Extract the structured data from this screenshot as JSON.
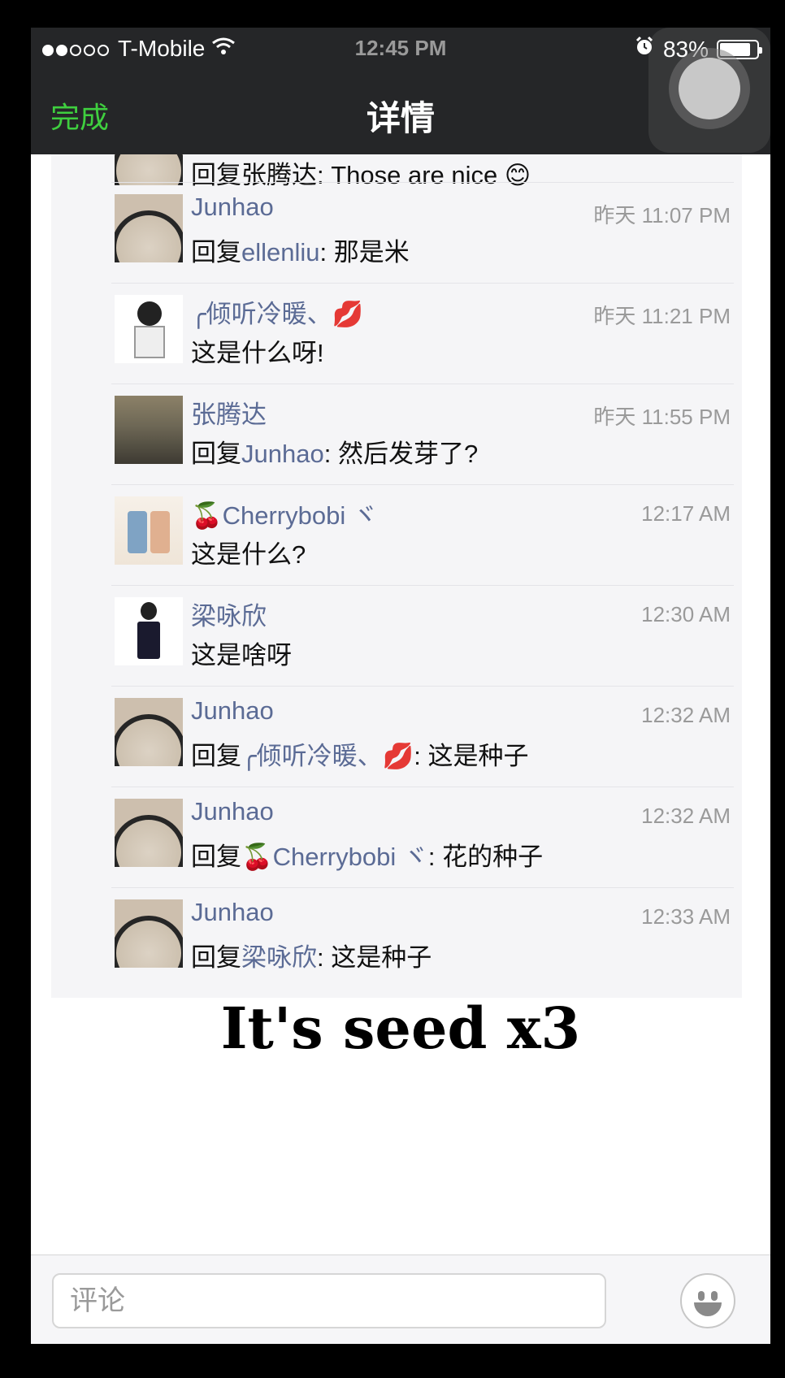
{
  "status_bar": {
    "carrier": "T-Mobile",
    "time": "12:45 PM",
    "battery": "83%",
    "battery_level": 0.83,
    "signal_bars_filled": 2,
    "signal_bars_total": 5
  },
  "nav": {
    "done_label": "完成",
    "title": "详情",
    "accent_color": "#3fcf3f"
  },
  "comments": {
    "partial_text": "回复张腾达: Those are nice 😊",
    "items": [
      {
        "name": "Junhao",
        "time": "昨天 11:07 PM",
        "reply_prefix": "回复",
        "reply_to": "ellenliu",
        "message": ": 那是米"
      },
      {
        "name": "╭倾听冷暖、💋",
        "time": "昨天 11:21 PM",
        "reply_prefix": "",
        "reply_to": "",
        "message": "这是什么呀!"
      },
      {
        "name": "张腾达",
        "time": "昨天 11:55 PM",
        "reply_prefix": "回复",
        "reply_to": "Junhao",
        "message": ": 然后发芽了?"
      },
      {
        "name": "🍒Cherrybobi ヾ",
        "time": "12:17 AM",
        "reply_prefix": "",
        "reply_to": "",
        "message": "这是什么?"
      },
      {
        "name": "梁咏欣",
        "time": "12:30 AM",
        "reply_prefix": "",
        "reply_to": "",
        "message": "这是啥呀"
      },
      {
        "name": "Junhao",
        "time": "12:32 AM",
        "reply_prefix": "回复",
        "reply_to": "╭倾听冷暖、💋",
        "message": ": 这是种子"
      },
      {
        "name": "Junhao",
        "time": "12:32 AM",
        "reply_prefix": "回复",
        "reply_to": "🍒Cherrybobi ヾ",
        "message": ": 花的种子"
      },
      {
        "name": "Junhao",
        "time": "12:33 AM",
        "reply_prefix": "回复",
        "reply_to": "梁咏欣",
        "message": ": 这是种子"
      }
    ]
  },
  "caption": "It's seed x3",
  "input": {
    "placeholder": "评论"
  },
  "icons": {
    "wifi": "wifi-icon",
    "alarm": "alarm-clock-icon",
    "battery": "battery-icon",
    "emoji": "smiley-face-icon",
    "assistive_touch": "assistive-touch-icon"
  },
  "colors": {
    "link": "#5b6b95",
    "bar_bg": "#252628",
    "comment_bg": "#f5f5f7"
  }
}
